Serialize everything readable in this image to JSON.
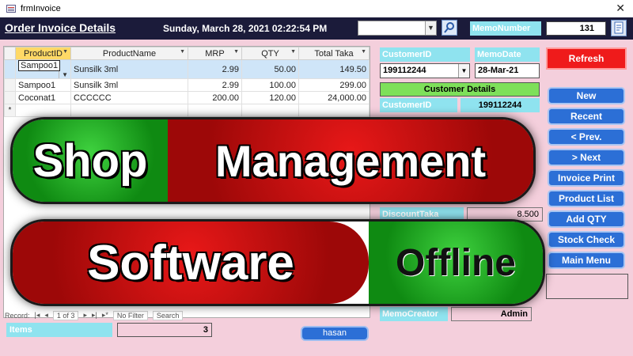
{
  "window": {
    "title": "frmInvoice",
    "close_glyph": "✕"
  },
  "header": {
    "form_title": "Order Invoice Details",
    "datetime": "Sunday, March 28, 2021   02:22:54 PM",
    "search_value": "",
    "memo_label": "MemoNumber",
    "memo_value": "131"
  },
  "grid": {
    "columns": [
      "ProductID",
      "ProductName",
      "MRP",
      "QTY",
      "Total Taka"
    ],
    "rows": [
      {
        "id": "Sampoo1",
        "name": "Sunsilk 3ml",
        "mrp": "2.99",
        "qty": "50.00",
        "total": "149.50"
      },
      {
        "id": "Sampoo1",
        "name": "Sunsilk 3ml",
        "mrp": "2.99",
        "qty": "100.00",
        "total": "299.00"
      },
      {
        "id": "Coconat1",
        "name": "CCCCCC",
        "mrp": "200.00",
        "qty": "120.00",
        "total": "24,000.00"
      }
    ],
    "new_row_marker": "*"
  },
  "nav": {
    "record_label": "Record:",
    "position": "1 of 3",
    "filter": "No Filter",
    "search": "Search"
  },
  "footer": {
    "items_label": "Items",
    "items_value": "3",
    "user": "hasan"
  },
  "form": {
    "customer_id_label": "CustomerID",
    "customer_id_value": "199112244",
    "memo_date_label": "MemoDate",
    "memo_date_value": "28-Mar-21",
    "customer_details": "Customer Details",
    "detail_customer_id_label": "CustomerID",
    "detail_customer_id_value": "199112244",
    "discount_label": "DiscountTaka",
    "discount_value": "8.500",
    "memo_creator_label": "MemoCreator",
    "memo_creator_value": "Admin"
  },
  "buttons": {
    "refresh": "Refresh",
    "new": "New",
    "recent": "Recent",
    "prev": "< Prev.",
    "next": "> Next",
    "invoice_print": "Invoice Print",
    "product_list": "Product List",
    "add_qty": "Add QTY",
    "stock_check": "Stock Check",
    "main_menu": "Main Menu"
  },
  "banner": {
    "line1_a": "Shop",
    "line1_b": "Management",
    "line2_a": "Software",
    "line2_b": "Offline"
  },
  "colors": {
    "header_bg": "#1b1b3a",
    "form_bg": "#f4cfdc",
    "label_cyan": "#8fe3ef",
    "button_blue": "#2c6fd6",
    "refresh_red": "#ef1b1b",
    "banner_red": "#d01010",
    "banner_green": "#22b022"
  }
}
